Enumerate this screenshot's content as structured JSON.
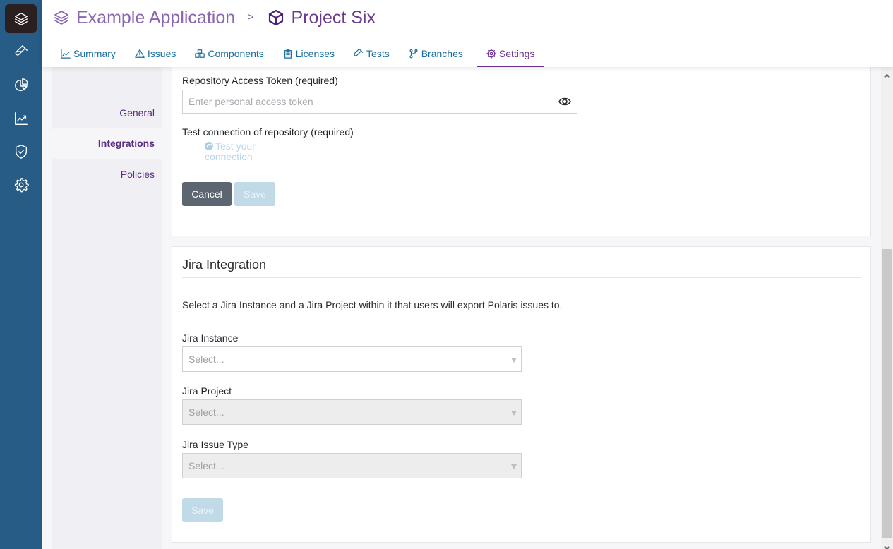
{
  "rail": {
    "items": [
      {
        "name": "layers-icon",
        "label": "Applications"
      },
      {
        "name": "test-tube-icon",
        "label": "Tests"
      },
      {
        "name": "pie-chart-icon",
        "label": "Reports"
      },
      {
        "name": "trend-chart-icon",
        "label": "Trends"
      },
      {
        "name": "shield-check-icon",
        "label": "Policies"
      },
      {
        "name": "gear-icon",
        "label": "Settings"
      }
    ]
  },
  "header": {
    "breadcrumb": {
      "application": "Example Application",
      "separator": ">",
      "project": "Project Six"
    },
    "tabs": [
      {
        "label": "Summary",
        "icon": "line-chart-icon",
        "active": false
      },
      {
        "label": "Issues",
        "icon": "warning-icon",
        "active": false
      },
      {
        "label": "Components",
        "icon": "boxes-icon",
        "active": false
      },
      {
        "label": "Licenses",
        "icon": "clipboard-icon",
        "active": false
      },
      {
        "label": "Tests",
        "icon": "test-tube-icon",
        "active": false
      },
      {
        "label": "Branches",
        "icon": "branch-icon",
        "active": false
      },
      {
        "label": "Settings",
        "icon": "gear-icon",
        "active": true
      }
    ]
  },
  "subnav": {
    "items": [
      {
        "label": "General",
        "active": false
      },
      {
        "label": "Integrations",
        "active": true
      },
      {
        "label": "Policies",
        "active": false
      }
    ]
  },
  "repo_card": {
    "token_label": "Repository Access Token (required)",
    "token_value": "",
    "token_placeholder": "Enter personal access token",
    "test_label": "Test connection of repository (required)",
    "test_link_line1": "Test your",
    "test_link_line2": "connection",
    "cancel_label": "Cancel",
    "save_label": "Save"
  },
  "jira_card": {
    "title": "Jira Integration",
    "description": "Select a Jira Instance and a Jira Project within it that users will export Polaris issues to.",
    "instance_label": "Jira Instance",
    "instance_value": "Select...",
    "project_label": "Jira Project",
    "project_value": "Select...",
    "issue_type_label": "Jira Issue Type",
    "issue_type_value": "Select...",
    "save_label": "Save"
  },
  "colors": {
    "rail": "#265c85",
    "accent_purple": "#6a2f91",
    "tab_blue": "#1a6f9e",
    "disabled_button": "#c0dbe7",
    "cancel_button": "#5c6670"
  }
}
